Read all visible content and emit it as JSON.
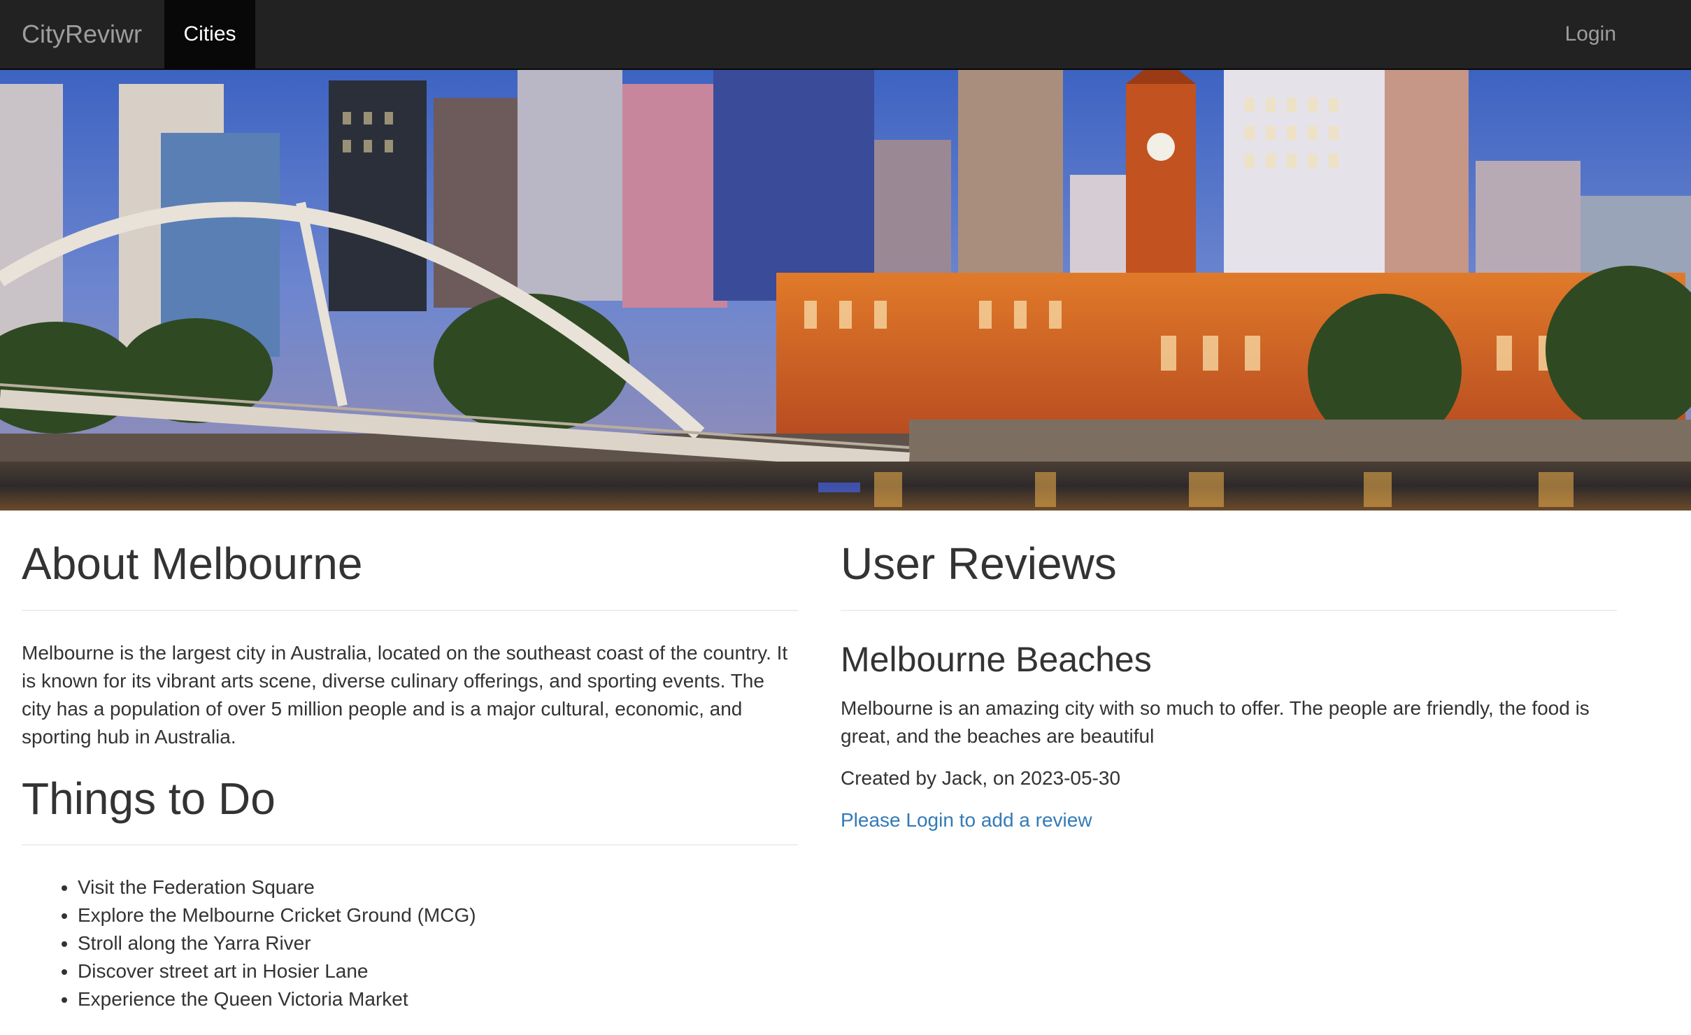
{
  "nav": {
    "brand": "CityReviwr",
    "active_item": "Cities",
    "login_label": "Login"
  },
  "hero": {
    "alt": "Melbourne skyline",
    "icon": "city-skyline-image"
  },
  "about": {
    "title": "About Melbourne",
    "text": "Melbourne is the largest city in Australia, located on the southeast coast of the country. It is known for its vibrant arts scene, diverse culinary offerings, and sporting events. The city has a population of over 5 million people and is a major cultural, economic, and sporting hub in Australia."
  },
  "things": {
    "title": "Things to Do",
    "items": [
      "Visit the Federation Square",
      "Explore the Melbourne Cricket Ground (MCG)",
      "Stroll along the Yarra River",
      "Discover street art in Hosier Lane",
      "Experience the Queen Victoria Market"
    ]
  },
  "reviews": {
    "title": "User Reviews",
    "items": [
      {
        "title": "Melbourne Beaches",
        "body": "Melbourne is an amazing city with so much to offer. The people are friendly, the food is great, and the beaches are beautiful",
        "meta": "Created by Jack, on 2023-05-30"
      }
    ],
    "login_prompt": "Please Login to add a review"
  },
  "colors": {
    "navbar_bg": "#222222",
    "nav_active_bg": "#080808",
    "link": "#337ab7",
    "text": "#333333"
  }
}
